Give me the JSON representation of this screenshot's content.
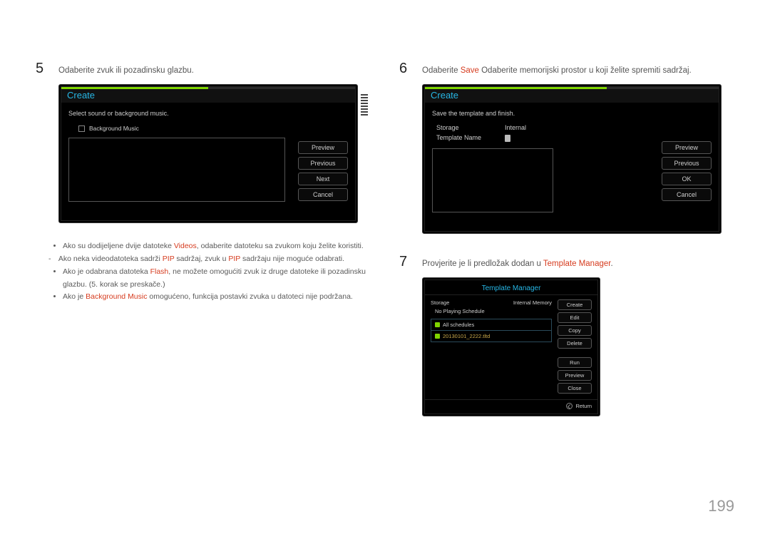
{
  "page_number": "199",
  "left": {
    "step5": {
      "num": "5",
      "text": "Odaberite zvuk ili pozadinsku glazbu."
    },
    "screen1": {
      "title": "Create",
      "instruction": "Select sound or background music.",
      "checkbox_label": "Background Music",
      "buttons": {
        "preview": "Preview",
        "previous": "Previous",
        "next": "Next",
        "cancel": "Cancel"
      }
    },
    "bullets": {
      "b1_pre": "Ako su dodijeljene dvije datoteke ",
      "b1_red": "Videos",
      "b1_post": ", odaberite datoteku sa zvukom koju želite koristiti.",
      "b1s_pre": "Ako neka videodatoteka sadrži ",
      "b1s_red1": "PIP",
      "b1s_mid": " sadržaj, zvuk u ",
      "b1s_red2": "PIP",
      "b1s_post": " sadržaju nije moguće odabrati.",
      "b2_pre": "Ako je odabrana datoteka ",
      "b2_red": "Flash",
      "b2_post": ", ne možete omogućiti zvuk iz druge datoteke ili pozadinsku glazbu. (5. korak se preskače.)",
      "b3_pre": "Ako je ",
      "b3_red": "Background Music",
      "b3_post": " omogućeno, funkcija postavki zvuka u datoteci nije podržana."
    }
  },
  "right": {
    "step6": {
      "num": "6",
      "pre": "Odaberite ",
      "red": "Save",
      "post": " Odaberite memorijski prostor u koji želite spremiti sadržaj."
    },
    "screen2": {
      "title": "Create",
      "instruction": "Save the template and ﬁnish.",
      "storage_label": "Storage",
      "storage_value": "Internal",
      "template_label": "Template Name",
      "buttons": {
        "preview": "Preview",
        "previous": "Previous",
        "ok": "OK",
        "cancel": "Cancel"
      }
    },
    "step7": {
      "num": "7",
      "pre": "Provjerite je li predložak dodan u ",
      "red": "Template Manager",
      "post": "."
    },
    "screen3": {
      "title": "Template Manager",
      "storage_label": "Storage",
      "storage_value": "Internal Memory",
      "no_schedule": "No Playing Schedule",
      "all_schedules": "All schedules",
      "item": "20130101_2222.tltd",
      "buttons": {
        "create": "Create",
        "edit": "Edit",
        "copy": "Copy",
        "delete": "Delete",
        "run": "Run",
        "preview": "Preview",
        "close": "Close"
      },
      "return": "Return"
    }
  }
}
